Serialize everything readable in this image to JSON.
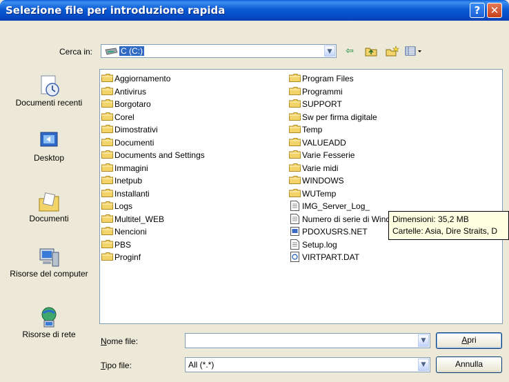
{
  "window": {
    "title": "Selezione file per introduzione rapida"
  },
  "title_buttons": {
    "help": "?",
    "close": "✕"
  },
  "lookin": {
    "label": "Cerca in:",
    "value": "C (C:)"
  },
  "places": [
    {
      "name": "recent",
      "label": "Documenti recenti"
    },
    {
      "name": "desktop",
      "label": "Desktop"
    },
    {
      "name": "documents",
      "label": "Documenti"
    },
    {
      "name": "computer",
      "label": "Risorse del computer"
    },
    {
      "name": "network",
      "label": "Risorse di rete"
    }
  ],
  "files_col1": [
    {
      "name": "Aggiornamento",
      "type": "folder"
    },
    {
      "name": "Antivirus",
      "type": "folder"
    },
    {
      "name": "Borgotaro",
      "type": "folder"
    },
    {
      "name": "Corel",
      "type": "folder"
    },
    {
      "name": "Dimostrativi",
      "type": "folder"
    },
    {
      "name": "Documenti",
      "type": "folder"
    },
    {
      "name": "Documents and Settings",
      "type": "folder"
    },
    {
      "name": "Immagini",
      "type": "folder"
    },
    {
      "name": "Inetpub",
      "type": "folder"
    },
    {
      "name": "Installanti",
      "type": "folder"
    },
    {
      "name": "Logs",
      "type": "folder"
    },
    {
      "name": "Multitel_WEB",
      "type": "folder"
    },
    {
      "name": "Nencioni",
      "type": "folder"
    },
    {
      "name": "PBS",
      "type": "folder"
    },
    {
      "name": "Proginf",
      "type": "folder"
    }
  ],
  "files_col2": [
    {
      "name": "Program Files",
      "type": "folder"
    },
    {
      "name": "Programmi",
      "type": "folder"
    },
    {
      "name": "SUPPORT",
      "type": "folder"
    },
    {
      "name": "Sw per firma digitale",
      "type": "folder"
    },
    {
      "name": "Temp",
      "type": "folder"
    },
    {
      "name": "VALUEADD",
      "type": "folder"
    },
    {
      "name": "Varie Fesserie",
      "type": "folder"
    },
    {
      "name": "Varie midi",
      "type": "folder"
    },
    {
      "name": "WINDOWS",
      "type": "folder"
    },
    {
      "name": "WUTemp",
      "type": "folder"
    },
    {
      "name": "IMG_Server_Log_",
      "type": "text"
    },
    {
      "name": "Numero di serie di Windows XP Pro.txt",
      "type": "text"
    },
    {
      "name": "PDOXUSRS.NET",
      "type": "net"
    },
    {
      "name": "Setup.log",
      "type": "text"
    },
    {
      "name": "VIRTPART.DAT",
      "type": "dat"
    }
  ],
  "tooltip": {
    "line1": "Dimensioni: 35,2 MB",
    "line2": "Cartelle: Asia, Dire Straits, D"
  },
  "filename": {
    "label": "Nome file:",
    "value": ""
  },
  "filetype": {
    "label": "Tipo file:",
    "value": "All (*.*)"
  },
  "buttons": {
    "open": "Apri",
    "cancel": "Annulla"
  },
  "colors": {
    "title_bar": "#0a5bd4",
    "dialog_bg": "#ece9d8",
    "selection": "#316ac5",
    "folder": "#f2d46a"
  }
}
